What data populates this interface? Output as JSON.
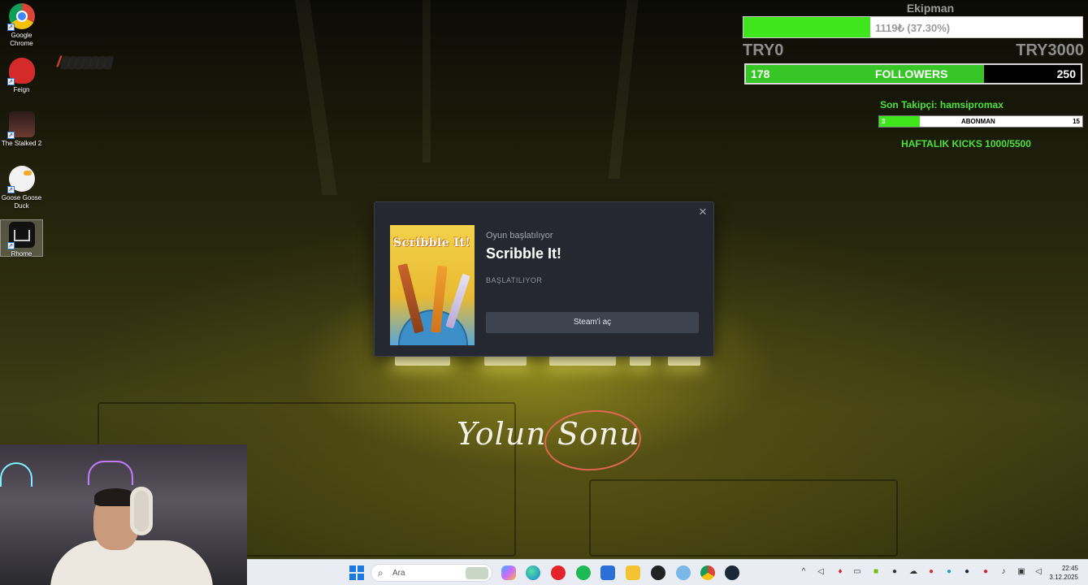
{
  "desktop_icons": [
    {
      "label": "Google Chrome",
      "icon": "chrome-icon"
    },
    {
      "label": "Feign",
      "icon": "feign-icon"
    },
    {
      "label": "The Stalked 2",
      "icon": "stalked-icon"
    },
    {
      "label": "Goose Goose Duck",
      "icon": "goose-icon"
    },
    {
      "label": "Rhome",
      "icon": "rhome-icon"
    }
  ],
  "overlay": {
    "title": "Ekipman",
    "donation": {
      "text": "1119₺ (37.30%)",
      "progress": 0.373,
      "min_label": "TRY0",
      "max_label": "TRY3000"
    },
    "followers": {
      "current": "178",
      "label": "FOLLOWERS",
      "goal": "250",
      "progress": 0.712
    },
    "last_follower": "Son Takipçi: hamsipromax",
    "subs": {
      "current": "3",
      "label": "ABONMAN",
      "goal": "15",
      "progress": 0.2
    },
    "kicks": "HAFTALIK KICKS 1000/5500"
  },
  "dialog": {
    "subtitle": "Oyun başlatılıyor",
    "title": "Scribble It!",
    "status": "BAŞLATILIYOR",
    "button": "Steam'i aç",
    "cover_text": "Scribble It!"
  },
  "script_text": "Yolun Sonu",
  "taskbar": {
    "search_placeholder": "Ara",
    "time": "22:45",
    "date": "3.12.2025"
  },
  "colors": {
    "accent_green": "#3fe61c",
    "steam_bg": "#252830",
    "taskbar_bg": "#e9edf3"
  }
}
